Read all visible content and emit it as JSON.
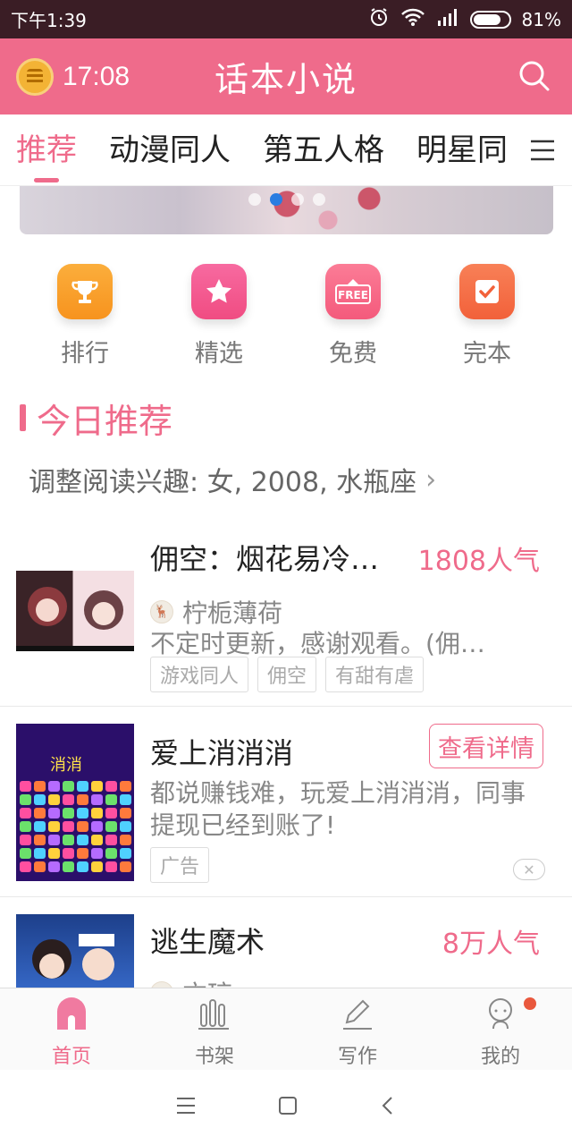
{
  "status_bar": {
    "time": "下午1:39",
    "battery": "81%",
    "battery_level": 0.81
  },
  "header": {
    "clock": "17:08",
    "title": "话本小说"
  },
  "tabs": [
    {
      "label": "推荐",
      "active": true
    },
    {
      "label": "动漫同人",
      "active": false
    },
    {
      "label": "第五人格",
      "active": false
    },
    {
      "label": "明星同",
      "active": false
    }
  ],
  "banner": {
    "page_count": 4,
    "active_index": 1
  },
  "quick_entries": [
    {
      "label": "排行",
      "icon": "trophy-icon",
      "color": "#f7931e"
    },
    {
      "label": "精选",
      "icon": "star-icon",
      "color": "#f04c82"
    },
    {
      "label": "免费",
      "icon": "free-icon",
      "color": "#f45a7c"
    },
    {
      "label": "完本",
      "icon": "check-icon",
      "color": "#f2613a"
    }
  ],
  "section": {
    "title": "今日推荐",
    "interest": "调整阅读兴趣: 女, 2008, 水瓶座"
  },
  "items": [
    {
      "title": "佣空：烟花易冷…",
      "popularity": "1808人气",
      "author": "柠栀薄荷",
      "desc": "不定时更新，感谢观看。(佣…",
      "tags": [
        "游戏同人",
        "佣空",
        "有甜有虐"
      ]
    },
    {
      "title": "爱上消消消",
      "detail_button": "查看详情",
      "desc": "都说赚钱难，玩爱上消消消，同事提现已经到账了!",
      "tags": [
        "广告"
      ]
    },
    {
      "title": "逃生魔术",
      "popularity": "8万人气",
      "author": "方琼"
    }
  ],
  "bottom_nav": [
    {
      "label": "首页",
      "icon": "home-icon",
      "active": true
    },
    {
      "label": "书架",
      "icon": "bookshelf-icon",
      "active": false
    },
    {
      "label": "写作",
      "icon": "pen-icon",
      "active": false
    },
    {
      "label": "我的",
      "icon": "profile-icon",
      "active": false,
      "badge": true
    }
  ],
  "colors": {
    "accent": "#ef6b8b",
    "status_bar_bg": "#3a1d25"
  }
}
